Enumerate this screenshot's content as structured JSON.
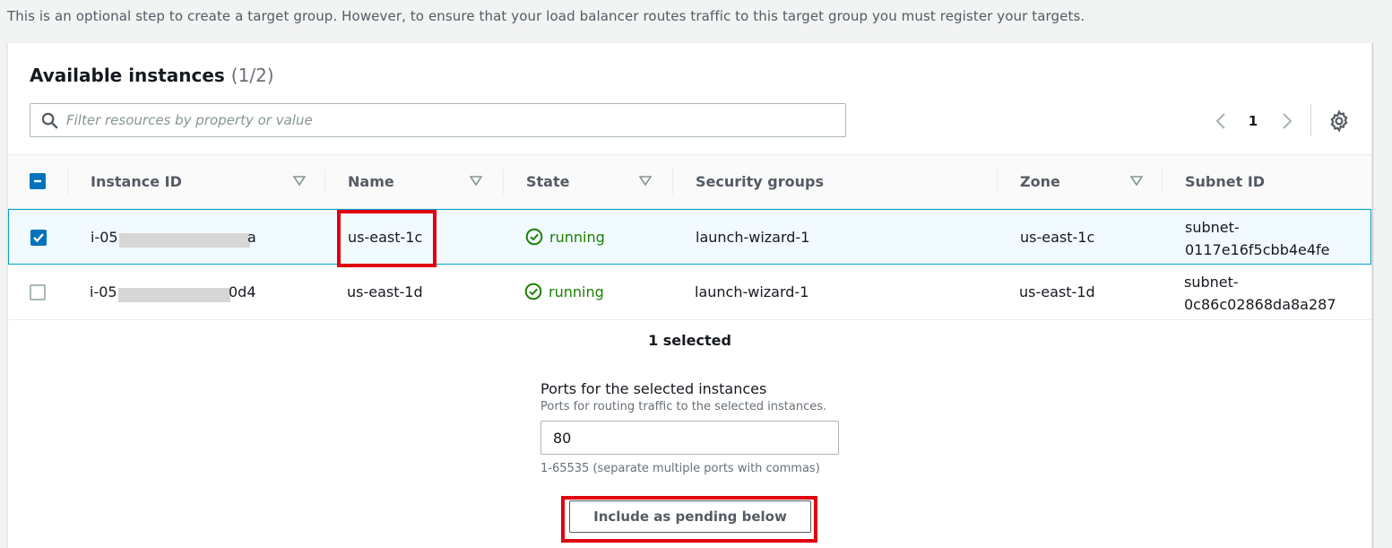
{
  "intro_text": "This is an optional step to create a target group. However, to ensure that your load balancer routes traffic to this target group you must register your targets.",
  "panel": {
    "title": "Available instances",
    "count": "(1/2)",
    "filter_placeholder": "Filter resources by property or value",
    "pagination": {
      "current_page": "1"
    }
  },
  "table": {
    "columns": {
      "instance_id": "Instance ID",
      "name": "Name",
      "state": "State",
      "security_groups": "Security groups",
      "zone": "Zone",
      "subnet_id": "Subnet ID"
    },
    "rows": [
      {
        "selected": true,
        "instance_id_prefix": "i-05",
        "instance_id_suffix": "a",
        "name": "us-east-1c",
        "state": "running",
        "security_groups": "launch-wizard-1",
        "zone": "us-east-1c",
        "subnet_line1": "subnet-",
        "subnet_line2": "0117e16f5cbb4e4fe"
      },
      {
        "selected": false,
        "instance_id_prefix": "i-05",
        "instance_id_suffix": "0d4",
        "name": "us-east-1d",
        "state": "running",
        "security_groups": "launch-wizard-1",
        "zone": "us-east-1d",
        "subnet_line1": "subnet-",
        "subnet_line2": "0c86c02868da8a287"
      }
    ]
  },
  "selection": {
    "selected_text": "1 selected",
    "ports_label": "Ports for the selected instances",
    "ports_description": "Ports for routing traffic to the selected instances.",
    "ports_value": "80",
    "ports_constraint": "1-65535 (separate multiple ports with commas)",
    "include_button": "Include as pending below"
  },
  "colors": {
    "running": "#1d8102",
    "checkbox_checked": "#0073bb",
    "selected_row_border": "#00a1c9",
    "annotation_red": "#e0000e"
  }
}
